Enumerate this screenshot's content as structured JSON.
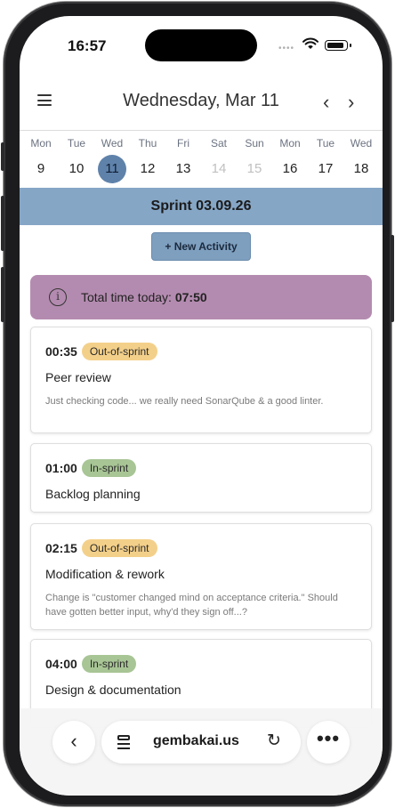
{
  "status_bar": {
    "time": "16:57",
    "signal": "••••"
  },
  "header": {
    "title": "Wednesday, Mar 11",
    "prev_glyph": "‹",
    "next_glyph": "›",
    "menu_icon": "hamburger-menu-icon"
  },
  "week": {
    "days": [
      {
        "dow": "Mon",
        "num": "9",
        "state": "normal"
      },
      {
        "dow": "Tue",
        "num": "10",
        "state": "normal"
      },
      {
        "dow": "Wed",
        "num": "11",
        "state": "selected"
      },
      {
        "dow": "Thu",
        "num": "12",
        "state": "normal"
      },
      {
        "dow": "Fri",
        "num": "13",
        "state": "normal"
      },
      {
        "dow": "Sat",
        "num": "14",
        "state": "disabled"
      },
      {
        "dow": "Sun",
        "num": "15",
        "state": "disabled"
      },
      {
        "dow": "Mon",
        "num": "16",
        "state": "normal"
      },
      {
        "dow": "Tue",
        "num": "17",
        "state": "normal"
      },
      {
        "dow": "Wed",
        "num": "18",
        "state": "normal"
      }
    ]
  },
  "sprint": {
    "label": "Sprint 03.09.26",
    "color": "#86a6c6"
  },
  "actions": {
    "new_activity": "+ New Activity"
  },
  "summary": {
    "label": "Total time today:",
    "value": "07:50",
    "info_icon": "i",
    "color": "#b48bb0"
  },
  "activities": [
    {
      "duration": "00:35",
      "badge": "Out-of-sprint",
      "badge_type": "out",
      "title": "Peer review",
      "note": "Just checking code... we really need SonarQube & a good linter."
    },
    {
      "duration": "01:00",
      "badge": "In-sprint",
      "badge_type": "in",
      "title": "Backlog planning",
      "note": ""
    },
    {
      "duration": "02:15",
      "badge": "Out-of-sprint",
      "badge_type": "out",
      "title": "Modification & rework",
      "note": "Change is \"customer changed mind on acceptance criteria.\" Should have gotten better input, why'd they sign off...?"
    },
    {
      "duration": "04:00",
      "badge": "In-sprint",
      "badge_type": "in",
      "title": "Design & documentation",
      "note": ""
    }
  ],
  "browser_bar": {
    "url": "gembakai.us",
    "back_glyph": "‹",
    "reload_glyph": "↻",
    "more_glyph": "•••"
  },
  "colors": {
    "selected_day": "#5f82aa",
    "out_of_sprint": "#f3d08a",
    "in_sprint": "#a8c595"
  }
}
